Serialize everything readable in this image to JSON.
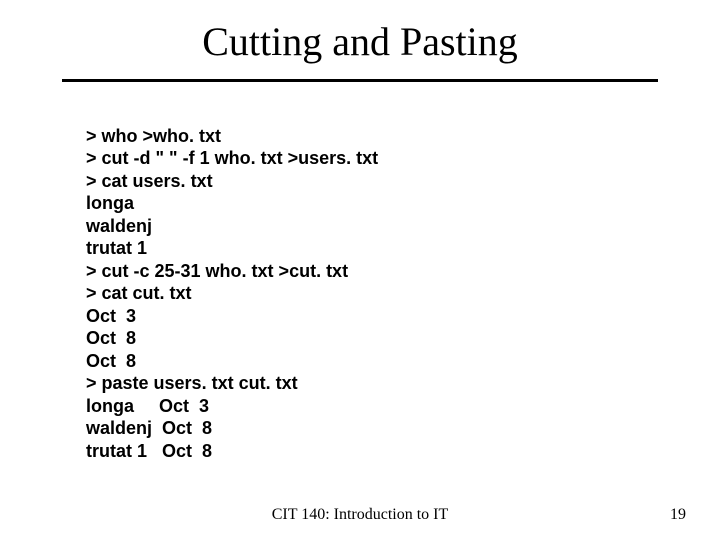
{
  "title": "Cutting and Pasting",
  "lines": [
    "> who >who. txt",
    "> cut -d \" \" -f 1 who. txt >users. txt",
    "> cat users. txt",
    "longa",
    "waldenj",
    "trutat 1",
    "> cut -c 25-31 who. txt >cut. txt",
    "> cat cut. txt",
    "Oct  3",
    "Oct  8",
    "Oct  8",
    "> paste users. txt cut. txt",
    "longa     Oct  3",
    "waldenj  Oct  8",
    "trutat 1   Oct  8"
  ],
  "footer_center": "CIT 140: Introduction to IT",
  "footer_right": "19"
}
